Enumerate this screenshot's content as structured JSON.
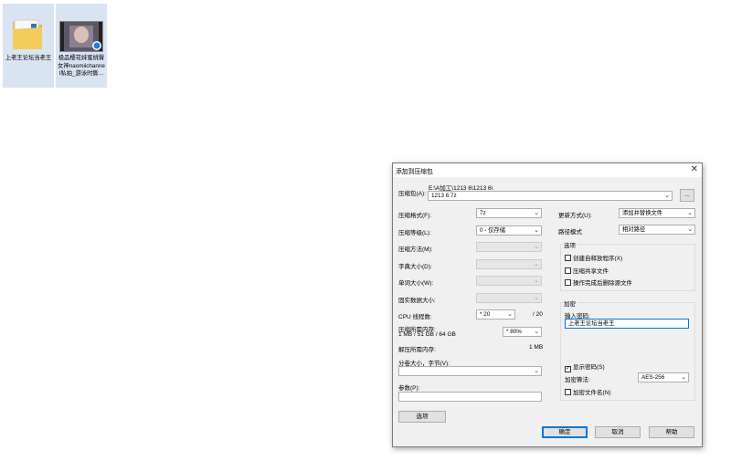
{
  "desktop": {
    "icons": [
      {
        "name": "上老王论坛当老王"
      },
      {
        "name": "极品樱花妹蜜桃臀女神naomiichannel私拍_游泳时撕..."
      }
    ]
  },
  "dialog": {
    "title": "添加到压缩包",
    "archive": {
      "label": "压缩包(A):",
      "path": "E:\\A加工\\1213 6\\1213 6\\",
      "filename": "1213 6.7z",
      "browse_label": "..."
    },
    "left": {
      "format_label": "压缩格式(F):",
      "format_value": "7z",
      "level_label": "压缩等级(L):",
      "level_value": "0 - 仅存储",
      "method_label": "压缩方法(M):",
      "dict_label": "字典大小(D):",
      "word_label": "单词大小(W):",
      "solid_label": "固实数据大小:",
      "cpu_label": "CPU 线程数:",
      "cpu_value": "* 20",
      "cpu_total": "/ 20",
      "mem_label": "压缩所需内存:",
      "mem_detail": "1 MB / 51 GB / 64 GB",
      "mem_percent": "* 80%",
      "decomp_label": "解压所需内存:",
      "decomp_value": "1 MB",
      "split_label": "分卷大小，字节(V):",
      "params_label": "参数(P):",
      "options_button": "选项"
    },
    "right": {
      "update_label": "更新方式(U):",
      "update_value": "添加并替换文件",
      "pathmode_label": "路径模式",
      "pathmode_value": "相对路径",
      "options_group": "选项",
      "opt_sfx": "创建自释放程序(X)",
      "opt_shared": "压缩共享文件",
      "opt_delete": "操作完成后删除源文件",
      "encrypt_group": "加密",
      "password_label": "输入密码:",
      "password_value": "上老王论坛当老王",
      "show_password": "显示密码(S)",
      "method_label": "加密算法:",
      "method_value": "AES-256",
      "encrypt_names": "加密文件名(N)"
    },
    "buttons": {
      "ok": "确定",
      "cancel": "取消",
      "help": "帮助"
    }
  }
}
